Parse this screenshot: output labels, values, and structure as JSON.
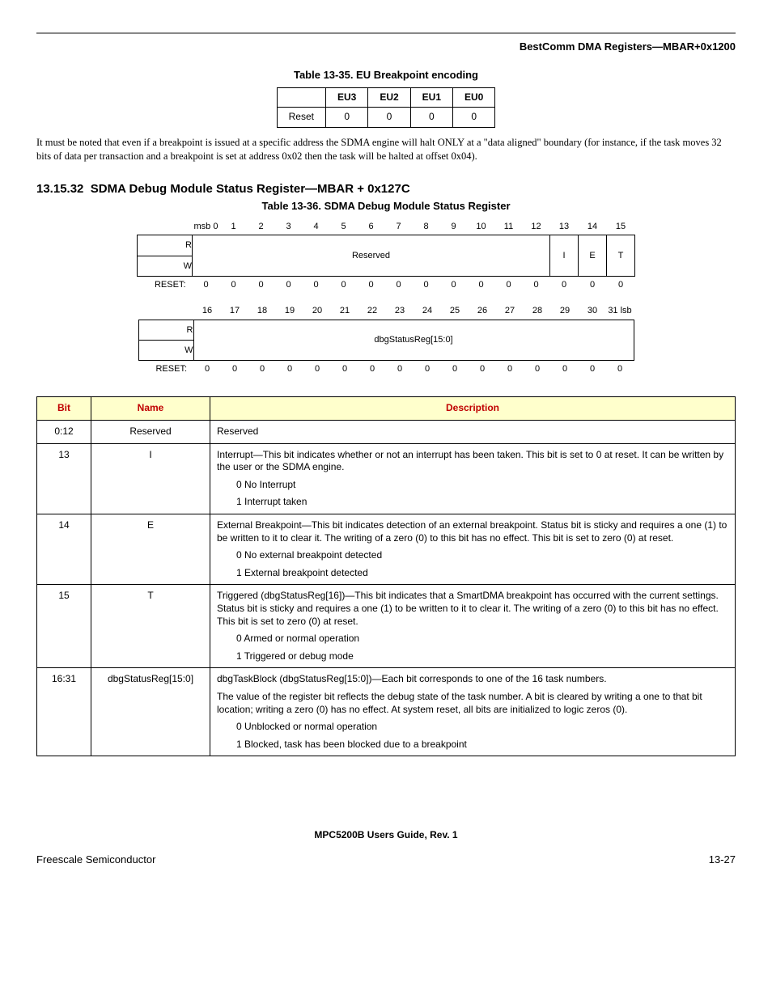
{
  "header": {
    "right": "BestComm DMA Registers—MBAR+0x1200"
  },
  "table35": {
    "caption": "Table 13-35. EU Breakpoint encoding",
    "headers": [
      "",
      "EU3",
      "EU2",
      "EU1",
      "EU0"
    ],
    "row": [
      "Reset",
      "0",
      "0",
      "0",
      "0"
    ]
  },
  "note": "It must be noted that even if a breakpoint is issued at a specific address the SDMA engine will halt ONLY at a \"data aligned\" boundary (for instance, if the task moves 32 bits of data per transaction and a breakpoint is set at address 0x02 then the task will be halted at offset 0x04).",
  "section": {
    "number": "13.15.32",
    "title": "SDMA Debug Module Status Register—MBAR + 0x127C"
  },
  "table36caption": "Table 13-36. SDMA Debug Module Status Register",
  "bits_upper": {
    "numbers": [
      "msb 0",
      "1",
      "2",
      "3",
      "4",
      "5",
      "6",
      "7",
      "8",
      "9",
      "10",
      "11",
      "12",
      "13",
      "14",
      "15"
    ],
    "r_label": "R",
    "w_label": "W",
    "reset_label": "RESET:",
    "reserved": "Reserved",
    "f13": "I",
    "f14": "E",
    "f15": "T",
    "reset": [
      "0",
      "0",
      "0",
      "0",
      "0",
      "0",
      "0",
      "0",
      "0",
      "0",
      "0",
      "0",
      "0",
      "0",
      "0",
      "0"
    ]
  },
  "bits_lower": {
    "numbers": [
      "16",
      "17",
      "18",
      "19",
      "20",
      "21",
      "22",
      "23",
      "24",
      "25",
      "26",
      "27",
      "28",
      "29",
      "30",
      "31 lsb"
    ],
    "r_label": "R",
    "w_label": "W",
    "reset_label": "RESET:",
    "span": "dbgStatusReg[15:0]",
    "reset": [
      "0",
      "0",
      "0",
      "0",
      "0",
      "0",
      "0",
      "0",
      "0",
      "0",
      "0",
      "0",
      "0",
      "0",
      "0",
      "0"
    ]
  },
  "desc": {
    "head": [
      "Bit",
      "Name",
      "Description"
    ],
    "rows": [
      {
        "bit": "0:12",
        "name": "Reserved",
        "lines": [
          "Reserved"
        ]
      },
      {
        "bit": "13",
        "name": "I",
        "lines": [
          "Interrupt—This bit indicates whether or not an interrupt has been taken. This bit is set to 0 at reset. It can be written by the user or the SDMA engine.",
          "0 No Interrupt",
          "1 Interrupt taken"
        ],
        "indent_from": 1
      },
      {
        "bit": "14",
        "name": "E",
        "lines": [
          "External Breakpoint—This bit indicates detection of an external breakpoint. Status bit is sticky and requires a one (1) to be written to it to clear it. The writing of a zero (0) to this bit has no effect. This bit is set to zero (0) at reset.",
          "0 No external breakpoint detected",
          "1 External breakpoint detected"
        ],
        "indent_from": 1
      },
      {
        "bit": "15",
        "name": "T",
        "lines": [
          "Triggered (dbgStatusReg[16])—This bit indicates that a SmartDMA breakpoint has occurred with the current settings. Status bit is sticky and requires a one (1) to be written to it to clear it. The writing of a zero (0) to this bit has no effect. This bit is set to zero (0) at reset.",
          "0 Armed or normal operation",
          "1 Triggered or debug mode"
        ],
        "indent_from": 1
      },
      {
        "bit": "16:31",
        "name": "dbgStatusReg[15:0]",
        "lines": [
          "dbgTaskBlock (dbgStatusReg[15:0])—Each bit corresponds to one of the 16 task numbers.",
          "The value of the register bit reflects the debug state of the task number. A bit is cleared by writing a one to that bit location; writing a zero (0) has no effect. At system reset, all bits are initialized to logic zeros (0).",
          "0 Unblocked or normal operation",
          "1 Blocked, task has been blocked due to a breakpoint"
        ],
        "indent_from": 2
      }
    ]
  },
  "footer": {
    "center": "MPC5200B Users Guide, Rev. 1",
    "left": "Freescale Semiconductor",
    "right": "13-27"
  }
}
